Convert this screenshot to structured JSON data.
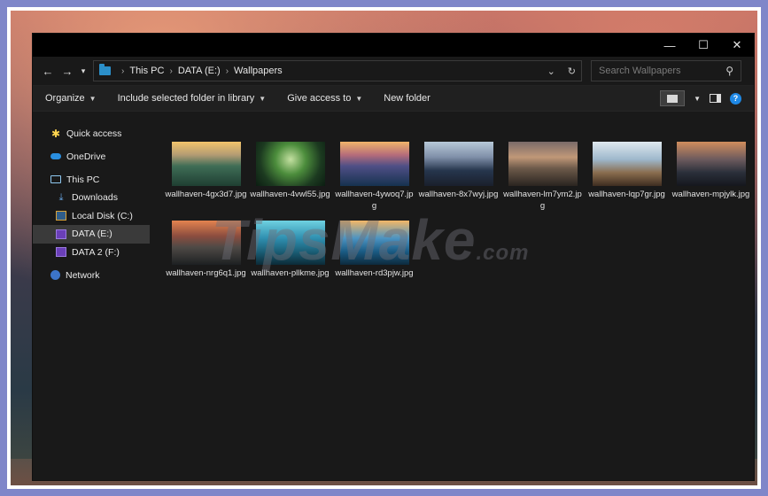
{
  "breadcrumb": [
    "This PC",
    "DATA (E:)",
    "Wallpapers"
  ],
  "search": {
    "placeholder": "Search Wallpapers"
  },
  "window_controls": {
    "minimize": "—",
    "maximize": "☐",
    "close": "✕"
  },
  "toolbar": {
    "organize": "Organize",
    "include": "Include selected folder in library",
    "give_access": "Give access to",
    "new_folder": "New folder"
  },
  "sidebar": {
    "items": [
      {
        "label": "Quick access",
        "icon": "star-icon"
      },
      {
        "label": "OneDrive",
        "icon": "cloud-icon"
      },
      {
        "label": "This PC",
        "icon": "computer-icon"
      },
      {
        "label": "Downloads",
        "icon": "download-icon"
      },
      {
        "label": "Local Disk (C:)",
        "icon": "disk-icon"
      },
      {
        "label": "DATA (E:)",
        "icon": "drive-icon"
      },
      {
        "label": "DATA 2 (F:)",
        "icon": "drive-icon"
      },
      {
        "label": "Network",
        "icon": "network-icon"
      }
    ]
  },
  "files": [
    {
      "name": "wallhaven-4gx3d7.jpg"
    },
    {
      "name": "wallhaven-4vwl55.jpg"
    },
    {
      "name": "wallhaven-4ywoq7.jpg"
    },
    {
      "name": "wallhaven-8x7wyj.jpg"
    },
    {
      "name": "wallhaven-lm7ym2.jpg"
    },
    {
      "name": "wallhaven-lqp7gr.jpg"
    },
    {
      "name": "wallhaven-mpjylk.jpg"
    },
    {
      "name": "wallhaven-nrg6q1.jpg"
    },
    {
      "name": "wallhaven-pllkme.jpg"
    },
    {
      "name": "wallhaven-rd3pjw.jpg"
    }
  ],
  "watermark": {
    "main": "TipsMake",
    "suffix": ".com"
  }
}
